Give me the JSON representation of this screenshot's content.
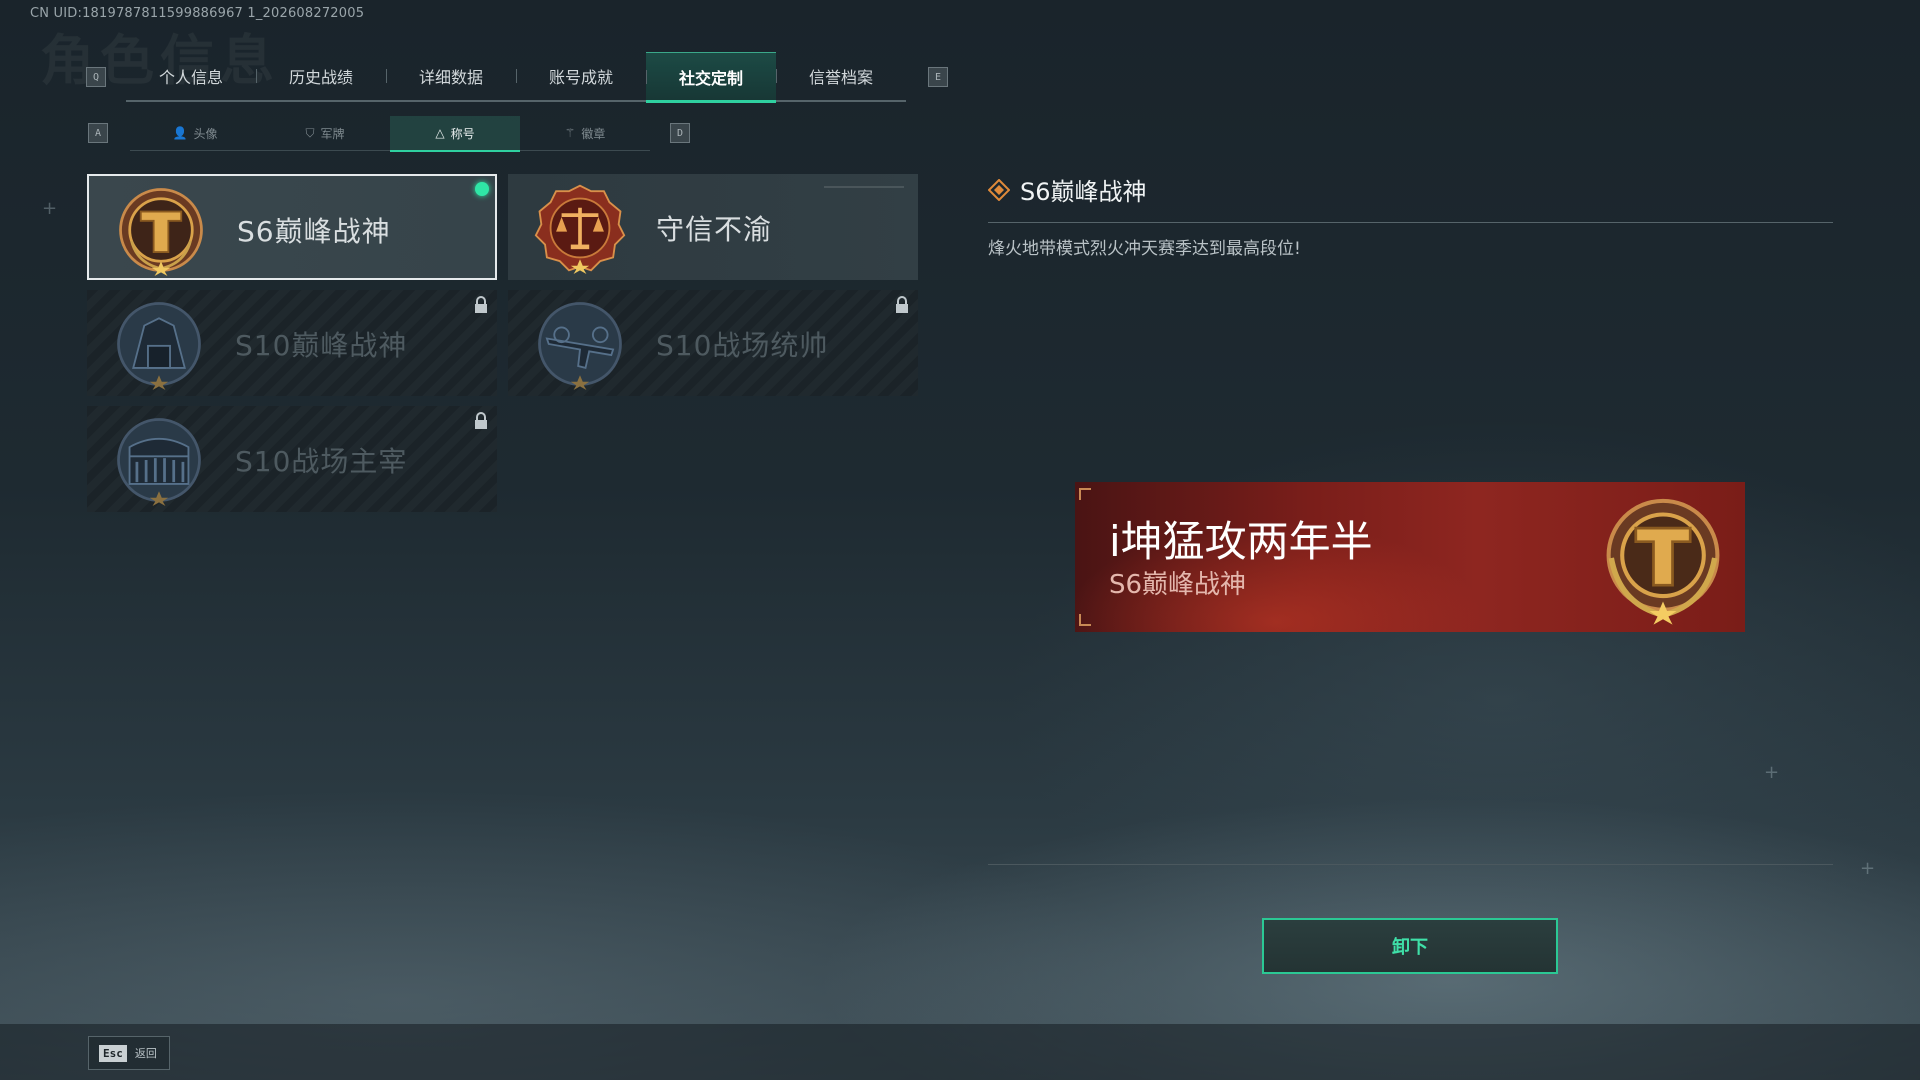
{
  "uid": "CN UID:1819787811599886967 1_202608272005",
  "tabs": {
    "prev_key": "Q",
    "next_key": "E",
    "items": [
      {
        "label": "个人信息"
      },
      {
        "label": "历史战绩"
      },
      {
        "label": "详细数据"
      },
      {
        "label": "账号成就"
      },
      {
        "label": "社交定制",
        "active": true
      },
      {
        "label": "信誉档案"
      }
    ]
  },
  "subtabs": {
    "prev_key": "A",
    "next_key": "D",
    "items": [
      {
        "label": "头像",
        "icon": "person-icon"
      },
      {
        "label": "军牌",
        "icon": "dogtag-icon"
      },
      {
        "label": "称号",
        "icon": "triangle-icon",
        "active": true
      },
      {
        "label": "徽章",
        "icon": "badge-icon"
      }
    ]
  },
  "titles": [
    {
      "name": "S6巅峰战神",
      "medal": "golden-pillar-medal",
      "unlocked": true,
      "equipped": true
    },
    {
      "name": "守信不渝",
      "medal": "scales-medal",
      "unlocked": true
    },
    {
      "name": "S10巅峰战神",
      "medal": "fortress-medal",
      "unlocked": false
    },
    {
      "name": "S10战场统帅",
      "medal": "aircraft-medal",
      "unlocked": false
    },
    {
      "name": "S10战场主宰",
      "medal": "colosseum-medal",
      "unlocked": false
    }
  ],
  "detail": {
    "title": "S6巅峰战神",
    "description": "烽火地带模式烈火冲天赛季达到最高段位!"
  },
  "preview": {
    "player_name": "i坤猛攻两年半",
    "title": "S6巅峰战神"
  },
  "actions": {
    "unequip_label": "卸下",
    "back_key": "Esc",
    "back_label": "返回"
  },
  "colors": {
    "accent": "#2fd0a0",
    "banner_red": "#7a1e1a",
    "medal_gold": "#d9a24a"
  }
}
